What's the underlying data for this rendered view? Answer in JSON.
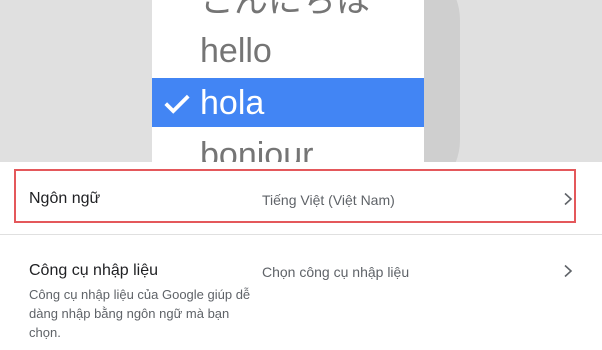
{
  "hero": {
    "languages_above": [
      "こんにちは",
      "hello"
    ],
    "selected_language": "hola",
    "languages_below": [
      "bonjour"
    ]
  },
  "settings": [
    {
      "title": "Ngôn ngữ",
      "value": "Tiếng Việt (Việt Nam)",
      "highlighted": true
    },
    {
      "title": "Công cụ nhập liệu",
      "value": "Chọn công cụ nhập liệu",
      "description": "Công cụ nhập liệu của Google giúp dễ dàng nhập bằng ngôn ngữ mà bạn chọn."
    }
  ],
  "colors": {
    "accent": "#4285f4",
    "highlight_border": "#e4585b",
    "hero_bg": "#e0e0e0"
  },
  "icons": [
    "check-icon",
    "chevron-right-icon"
  ]
}
